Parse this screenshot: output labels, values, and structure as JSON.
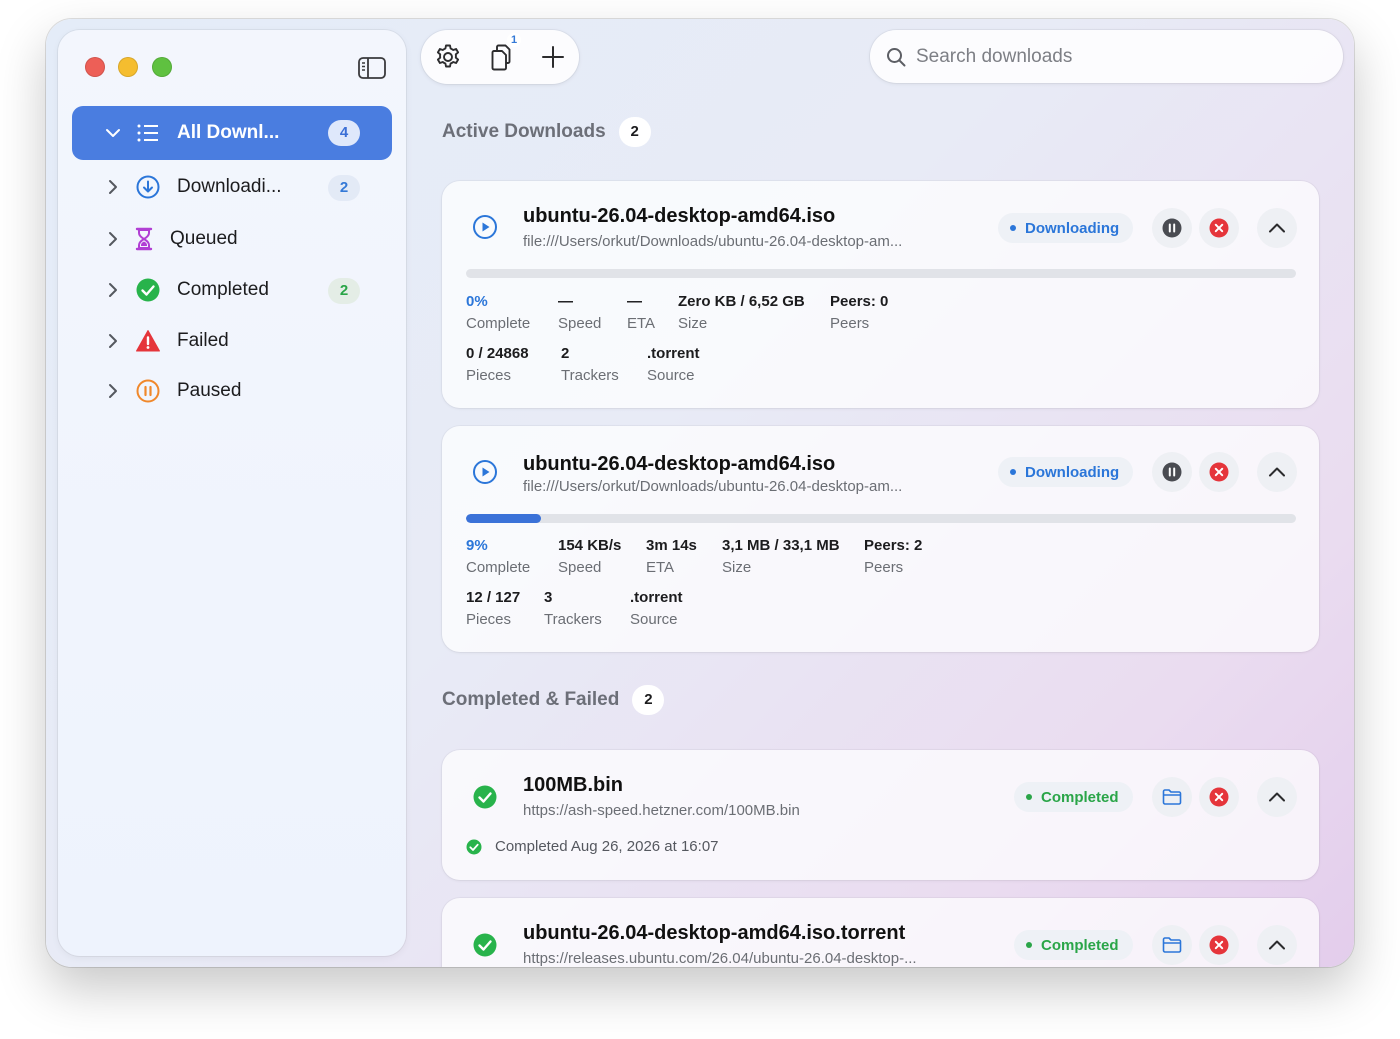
{
  "sidebar": {
    "items": [
      {
        "label": "All Downl...",
        "count": "4",
        "icon": "list-icon",
        "selected": true
      },
      {
        "label": "Downloadi...",
        "count": "2",
        "icon": "download-circle-icon"
      },
      {
        "label": "Queued",
        "count": "",
        "icon": "hourglass-icon"
      },
      {
        "label": "Completed",
        "count": "2",
        "icon": "checkmark-circle-icon"
      },
      {
        "label": "Failed",
        "count": "",
        "icon": "warning-triangle-icon"
      },
      {
        "label": "Paused",
        "count": "",
        "icon": "pause-circle-icon"
      }
    ]
  },
  "toolbar": {
    "badge_count": "1"
  },
  "search": {
    "placeholder": "Search downloads"
  },
  "sections": {
    "active": {
      "title": "Active Downloads",
      "count": "2"
    },
    "completed": {
      "title": "Completed & Failed",
      "count": "2"
    }
  },
  "active_downloads": [
    {
      "name": "ubuntu-26.04-desktop-amd64.iso",
      "url": "file:///Users/orkut/Downloads/ubuntu-26.04-desktop-am...",
      "status": "Downloading",
      "progress": 0,
      "stats": {
        "complete_value": "0%",
        "complete_label": "Complete",
        "speed_value": "—",
        "speed_label": "Speed",
        "eta_value": "—",
        "eta_label": "ETA",
        "size_value": "Zero KB / 6,52 GB",
        "size_label": "Size",
        "peers_value": "Peers: 0",
        "peers_label": "Peers",
        "pieces_value": "0 / 24868",
        "pieces_label": "Pieces",
        "trackers_value": "2",
        "trackers_label": "Trackers",
        "source_value": ".torrent",
        "source_label": "Source"
      }
    },
    {
      "name": "ubuntu-26.04-desktop-amd64.iso",
      "url": "file:///Users/orkut/Downloads/ubuntu-26.04-desktop-am...",
      "status": "Downloading",
      "progress": 0.09,
      "stats": {
        "complete_value": "9%",
        "complete_label": "Complete",
        "speed_value": "154 KB/s",
        "speed_label": "Speed",
        "eta_value": "3m 14s",
        "eta_label": "ETA",
        "size_value": "3,1 MB / 33,1 MB",
        "size_label": "Size",
        "peers_value": "Peers: 2",
        "peers_label": "Peers",
        "pieces_value": "12 / 127",
        "pieces_label": "Pieces",
        "trackers_value": "3",
        "trackers_label": "Trackers",
        "source_value": ".torrent",
        "source_label": "Source"
      }
    }
  ],
  "completed_downloads": [
    {
      "name": "100MB.bin",
      "url": "https://ash-speed.hetzner.com/100MB.bin",
      "status": "Completed",
      "note": "Completed Aug 26, 2026 at 16:07"
    },
    {
      "name": "ubuntu-26.04-desktop-amd64.iso.torrent",
      "url": "https://releases.ubuntu.com/26.04/ubuntu-26.04-desktop-...",
      "status": "Completed"
    }
  ],
  "colors": {
    "accent": "#4a7de0",
    "downloading": "#2b76d9",
    "completed": "#2aa548",
    "failed": "#e5353b",
    "paused": "#f0882b",
    "queued": "#b13fd4"
  }
}
